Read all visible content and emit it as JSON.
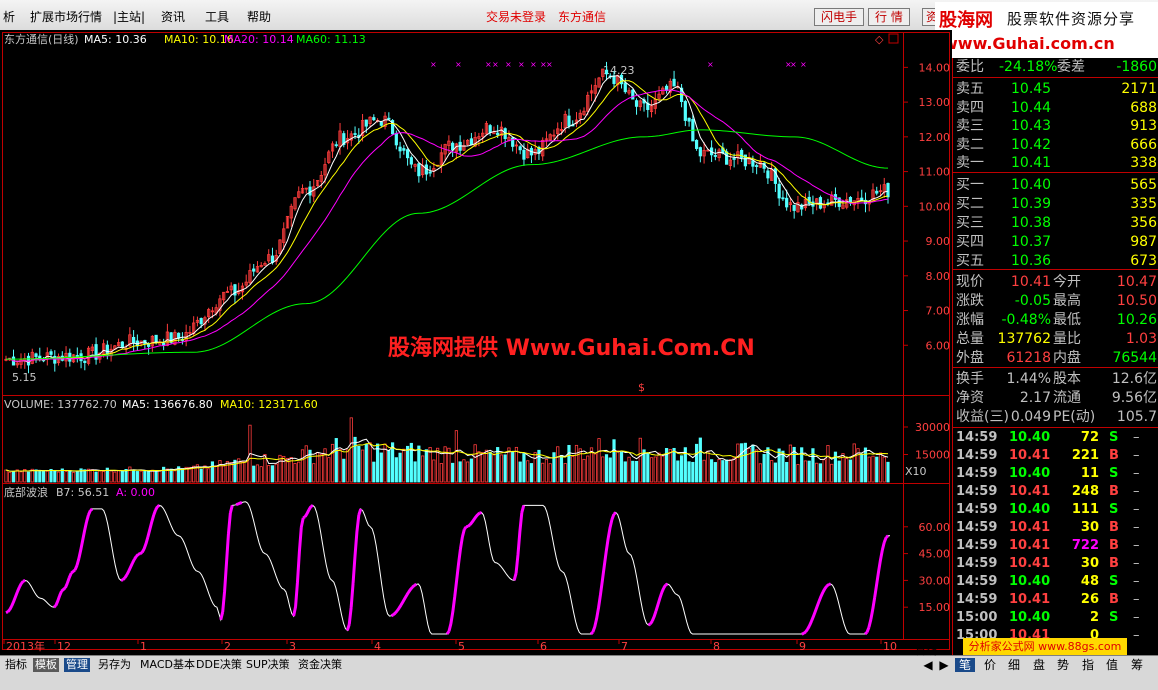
{
  "menu": {
    "items": [
      "析",
      "扩展市场行情",
      "|主站|",
      "资讯",
      "工具",
      "帮助"
    ],
    "status_left": "交易未登录",
    "status_right": "东方通信",
    "btn_flash": "闪电手",
    "btn_quote": "行 情",
    "btn_extra": "资"
  },
  "logo": {
    "brand": "股海网",
    "slogan": "股票软件资源分享",
    "url": "www.Guhai.com.cn"
  },
  "main_chart": {
    "legend": {
      "title": "东方通信(日线)",
      "ma5": "MA5: 10.36",
      "ma10": "MA10: 10.16",
      "ma20": "MA20: 10.14",
      "ma60": "MA60: 11.13"
    },
    "colors": {
      "ma5": "#ffffff",
      "ma10": "#ffff00",
      "ma20": "#ff00ff",
      "ma60": "#00ff00",
      "up": "#ff3c3c",
      "down": "#54ffff",
      "axis": "#c00000"
    },
    "high_label": "14.23",
    "low_label": "5.15",
    "marker": "$"
  },
  "volume_chart": {
    "legend": {
      "title": "VOLUME: 137762.70",
      "ma5": "MA5: 136676.80",
      "ma10": "MA10: 123171.60"
    },
    "unit": "X10"
  },
  "wave_chart": {
    "legend": {
      "title": "底部波浪",
      "b7": "B7: 56.51",
      "a": "A: 0.00"
    }
  },
  "chart_data": [
    {
      "type": "candlestick",
      "title": "东方通信(日线)",
      "y_ticks": [
        "14.00",
        "13.00",
        "12.00",
        "11.00",
        "10.00",
        "9.00",
        "8.00",
        "7.00",
        "6.00"
      ],
      "ylim": [
        5.0,
        14.5
      ],
      "x_ticks": [
        "2013年",
        "12",
        "1",
        "2",
        "3",
        "4",
        "5",
        "6",
        "7",
        "8",
        "9",
        "10"
      ],
      "annotations": {
        "high": 14.23,
        "low": 5.15
      },
      "trend_anchors": [
        [
          0,
          5.6
        ],
        [
          20,
          5.7
        ],
        [
          35,
          6.1
        ],
        [
          45,
          6.2
        ],
        [
          60,
          7.5
        ],
        [
          70,
          8.5
        ],
        [
          80,
          10.5
        ],
        [
          90,
          12.0
        ],
        [
          100,
          12.5
        ],
        [
          110,
          11.0
        ],
        [
          120,
          11.8
        ],
        [
          130,
          12.3
        ],
        [
          140,
          11.5
        ],
        [
          150,
          12.5
        ],
        [
          160,
          13.8
        ],
        [
          170,
          12.8
        ],
        [
          178,
          13.4
        ],
        [
          185,
          11.5
        ],
        [
          200,
          11.3
        ],
        [
          210,
          10.0
        ],
        [
          225,
          10.2
        ],
        [
          235,
          10.45
        ]
      ],
      "ma60_anchors": [
        [
          0,
          5.6
        ],
        [
          50,
          5.8
        ],
        [
          80,
          7.2
        ],
        [
          110,
          9.8
        ],
        [
          140,
          11.2
        ],
        [
          170,
          12.0
        ],
        [
          185,
          12.2
        ],
        [
          210,
          12.0
        ],
        [
          235,
          11.1
        ]
      ]
    },
    {
      "type": "bar",
      "title": "VOLUME",
      "y_ticks": [
        "30000",
        "15000"
      ],
      "ylim": [
        0,
        36000
      ],
      "last_value": 137762.7,
      "ma5": 136676.8,
      "ma10": 123171.6
    },
    {
      "type": "line",
      "title": "底部波浪",
      "y_ticks": [
        "60.00",
        "45.00",
        "30.00",
        "15.00"
      ],
      "ylim": [
        0,
        75
      ],
      "anchors": [
        [
          0,
          12
        ],
        [
          10,
          30
        ],
        [
          18,
          20
        ],
        [
          25,
          15
        ],
        [
          30,
          25
        ],
        [
          35,
          35
        ],
        [
          45,
          70
        ],
        [
          50,
          70
        ],
        [
          60,
          30
        ],
        [
          70,
          45
        ],
        [
          80,
          72
        ],
        [
          90,
          55
        ],
        [
          100,
          35
        ],
        [
          110,
          15
        ],
        [
          112,
          8
        ],
        [
          118,
          72
        ],
        [
          125,
          74
        ],
        [
          135,
          45
        ],
        [
          145,
          25
        ],
        [
          150,
          10
        ],
        [
          155,
          65
        ],
        [
          160,
          72
        ],
        [
          170,
          30
        ],
        [
          178,
          2
        ],
        [
          185,
          70
        ],
        [
          190,
          60
        ],
        [
          200,
          10
        ],
        [
          215,
          28
        ],
        [
          222,
          0
        ],
        [
          230,
          0
        ],
        [
          240,
          60
        ],
        [
          248,
          68
        ],
        [
          255,
          40
        ],
        [
          265,
          30
        ],
        [
          270,
          72
        ],
        [
          280,
          72
        ],
        [
          290,
          35
        ],
        [
          300,
          0
        ],
        [
          305,
          0
        ],
        [
          318,
          68
        ],
        [
          325,
          45
        ],
        [
          335,
          5
        ],
        [
          345,
          28
        ],
        [
          350,
          22
        ],
        [
          358,
          0
        ],
        [
          400,
          0
        ],
        [
          415,
          0
        ],
        [
          430,
          28
        ],
        [
          440,
          0
        ],
        [
          448,
          0
        ],
        [
          460,
          55
        ]
      ]
    }
  ],
  "right_panel": {
    "webi": {
      "l": "委比",
      "v1": "-24.18%",
      "l2": "委差",
      "v2": "-1860"
    },
    "asks": [
      {
        "l": "卖五",
        "p": "10.45",
        "q": "2171"
      },
      {
        "l": "卖四",
        "p": "10.44",
        "q": "688"
      },
      {
        "l": "卖三",
        "p": "10.43",
        "q": "913"
      },
      {
        "l": "卖二",
        "p": "10.42",
        "q": "666"
      },
      {
        "l": "卖一",
        "p": "10.41",
        "q": "338"
      }
    ],
    "bids": [
      {
        "l": "买一",
        "p": "10.40",
        "q": "565"
      },
      {
        "l": "买二",
        "p": "10.39",
        "q": "335"
      },
      {
        "l": "买三",
        "p": "10.38",
        "q": "356"
      },
      {
        "l": "买四",
        "p": "10.37",
        "q": "987"
      },
      {
        "l": "买五",
        "p": "10.36",
        "q": "673"
      }
    ],
    "quote": [
      {
        "l1": "现价",
        "v1": "10.41",
        "l2": "今开",
        "v2": "10.47",
        "c1": "#ff4040",
        "c2": "#ff4040"
      },
      {
        "l1": "涨跌",
        "v1": "-0.05",
        "l2": "最高",
        "v2": "10.50",
        "c1": "#00ff00",
        "c2": "#ff4040"
      },
      {
        "l1": "涨幅",
        "v1": "-0.48%",
        "l2": "最低",
        "v2": "10.26",
        "c1": "#00ff00",
        "c2": "#00ff00"
      },
      {
        "l1": "总量",
        "v1": "137762",
        "l2": "量比",
        "v2": "1.03",
        "c1": "#ffff00",
        "c2": "#ff4040"
      },
      {
        "l1": "外盘",
        "v1": "61218",
        "l2": "内盘",
        "v2": "76544",
        "c1": "#ff4040",
        "c2": "#00ff00"
      }
    ],
    "fund": [
      {
        "l1": "换手",
        "v1": "1.44%",
        "l2": "股本",
        "v2": "12.6亿"
      },
      {
        "l1": "净资",
        "v1": "2.17",
        "l2": "流通",
        "v2": "9.56亿"
      },
      {
        "l1": "收益(三)",
        "v1": "0.049",
        "l2": "PE(动)",
        "v2": "105.7"
      }
    ],
    "ticks": [
      {
        "t": "14:59",
        "p": "10.40",
        "v": "72",
        "s": "S",
        "pc": "#00ff00",
        "vc": "#ffff00",
        "sc": "#00ff00"
      },
      {
        "t": "14:59",
        "p": "10.41",
        "v": "221",
        "s": "B",
        "pc": "#ff4040",
        "vc": "#ffff00",
        "sc": "#ff4040"
      },
      {
        "t": "14:59",
        "p": "10.40",
        "v": "11",
        "s": "S",
        "pc": "#00ff00",
        "vc": "#ffff00",
        "sc": "#00ff00"
      },
      {
        "t": "14:59",
        "p": "10.41",
        "v": "248",
        "s": "B",
        "pc": "#ff4040",
        "vc": "#ffff00",
        "sc": "#ff4040"
      },
      {
        "t": "14:59",
        "p": "10.40",
        "v": "111",
        "s": "S",
        "pc": "#00ff00",
        "vc": "#ffff00",
        "sc": "#00ff00"
      },
      {
        "t": "14:59",
        "p": "10.41",
        "v": "30",
        "s": "B",
        "pc": "#ff4040",
        "vc": "#ffff00",
        "sc": "#ff4040"
      },
      {
        "t": "14:59",
        "p": "10.41",
        "v": "722",
        "s": "B",
        "pc": "#ff4040",
        "vc": "#ff00ff",
        "sc": "#ff4040"
      },
      {
        "t": "14:59",
        "p": "10.41",
        "v": "30",
        "s": "B",
        "pc": "#ff4040",
        "vc": "#ffff00",
        "sc": "#ff4040"
      },
      {
        "t": "14:59",
        "p": "10.40",
        "v": "48",
        "s": "S",
        "pc": "#00ff00",
        "vc": "#ffff00",
        "sc": "#00ff00"
      },
      {
        "t": "14:59",
        "p": "10.41",
        "v": "26",
        "s": "B",
        "pc": "#ff4040",
        "vc": "#ffff00",
        "sc": "#ff4040"
      },
      {
        "t": "15:00",
        "p": "10.40",
        "v": "2",
        "s": "S",
        "pc": "#00ff00",
        "vc": "#ffff00",
        "sc": "#00ff00"
      },
      {
        "t": "15:00",
        "p": "10.41",
        "v": "0",
        "s": "",
        "pc": "#ff4040",
        "vc": "#ffff00",
        "sc": "#ff4040"
      }
    ]
  },
  "bottom": {
    "tabs": [
      "指标",
      "模板",
      "管理",
      "另存为",
      "MACD基本",
      "DDE决策",
      "SUP决策",
      "资金决策"
    ],
    "period": "日线",
    "buttons": [
      "笔",
      "价",
      "细",
      "盘",
      "势",
      "指",
      "值",
      "筹"
    ]
  },
  "watermark": "股海网提供 Www.Guhai.Com.CN",
  "watermark2": "分析家公式网 www.88gs.com"
}
